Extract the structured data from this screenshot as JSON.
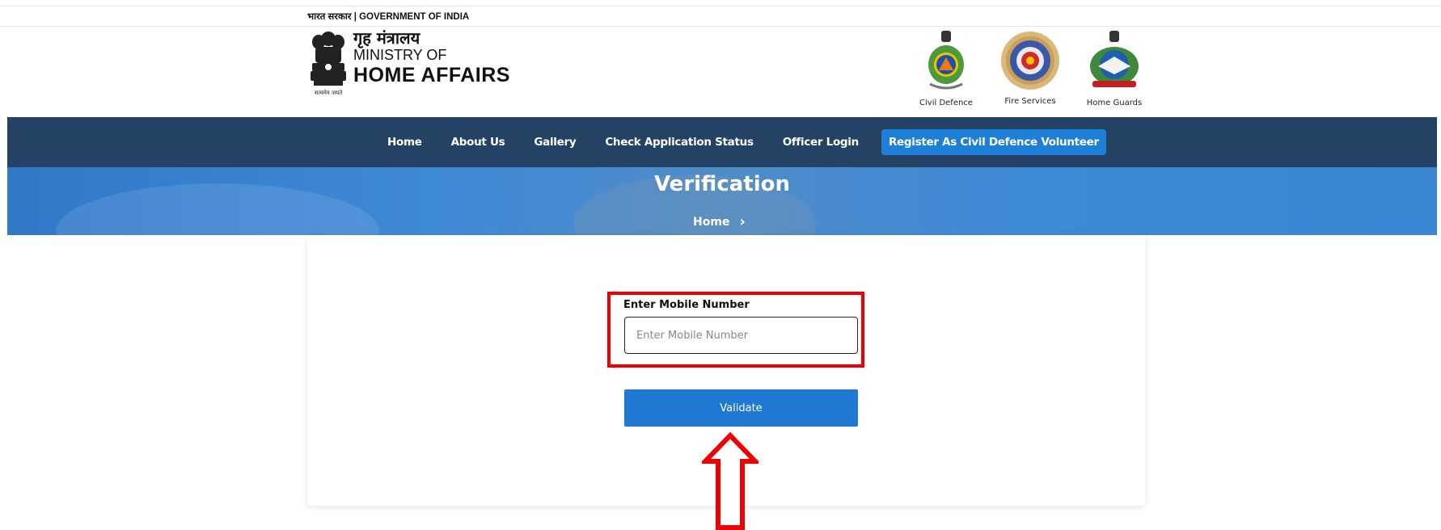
{
  "top_strip": {
    "text": "भारत सरकार | GOVERNMENT OF INDIA"
  },
  "brand": {
    "hindi": "गृह मंत्रालय",
    "ministry_of": "MINISTRY OF",
    "home_affairs": "HOME AFFAIRS",
    "emblem_motto": "सत्यमेव जयते"
  },
  "logos": [
    {
      "label": "Civil Defence",
      "icon": "civil-defence-emblem"
    },
    {
      "label": "Fire Services",
      "icon": "fire-services-emblem"
    },
    {
      "label": "Home Guards",
      "icon": "home-guards-emblem"
    }
  ],
  "nav": {
    "items": [
      "Home",
      "About Us",
      "Gallery",
      "Check Application Status",
      "Officer Login"
    ],
    "register": "Register As Civil Defence Volunteer"
  },
  "hero": {
    "title": "Verification",
    "breadcrumb_home": "Home",
    "breadcrumb_sep": "›"
  },
  "form": {
    "label": "Enter Mobile Number",
    "placeholder": "Enter Mobile Number",
    "value": "",
    "button": "Validate"
  },
  "colors": {
    "navbar": "#244264",
    "accent": "#1f78d1",
    "highlight": "#f00000"
  }
}
